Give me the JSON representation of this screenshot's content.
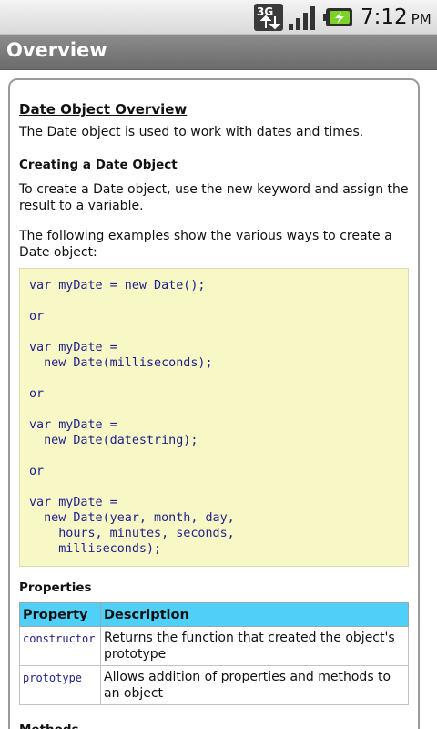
{
  "status_bar": {
    "network_icon": "3g-icon",
    "signal_icon": "signal-icon",
    "battery_icon": "battery-charging-icon",
    "time": "7:12",
    "ampm": "PM",
    "network_label": "3G"
  },
  "title_bar": {
    "title": "Overview"
  },
  "content": {
    "heading": "Date Object Overview",
    "intro": "The Date object is used to work with dates and times.",
    "create_heading": "Creating a Date Object",
    "create_text": "To create a Date object, use the new keyword and assign the result to a variable.",
    "examples_text": "The following examples show the various ways to create a Date object:",
    "code": "var myDate = new Date();\n\nor\n\nvar myDate =\n  new Date(milliseconds);\n\nor\n\nvar myDate =\n  new Date(datestring);\n\nor\n\nvar myDate =\n  new Date(year, month, day,\n    hours, minutes, seconds,\n    milliseconds);",
    "properties_heading": "Properties",
    "properties_table": {
      "headers": [
        "Property",
        "Description"
      ],
      "rows": [
        {
          "name": "constructor",
          "description": "Returns the function that created the object's prototype"
        },
        {
          "name": "prototype",
          "description": "Allows addition of properties and methods to an object"
        }
      ]
    },
    "methods_heading": "Methods"
  },
  "colors": {
    "table_header": "#4fd0f8",
    "code_background": "#f8f8c6",
    "code_text": "#1f1f8c"
  }
}
